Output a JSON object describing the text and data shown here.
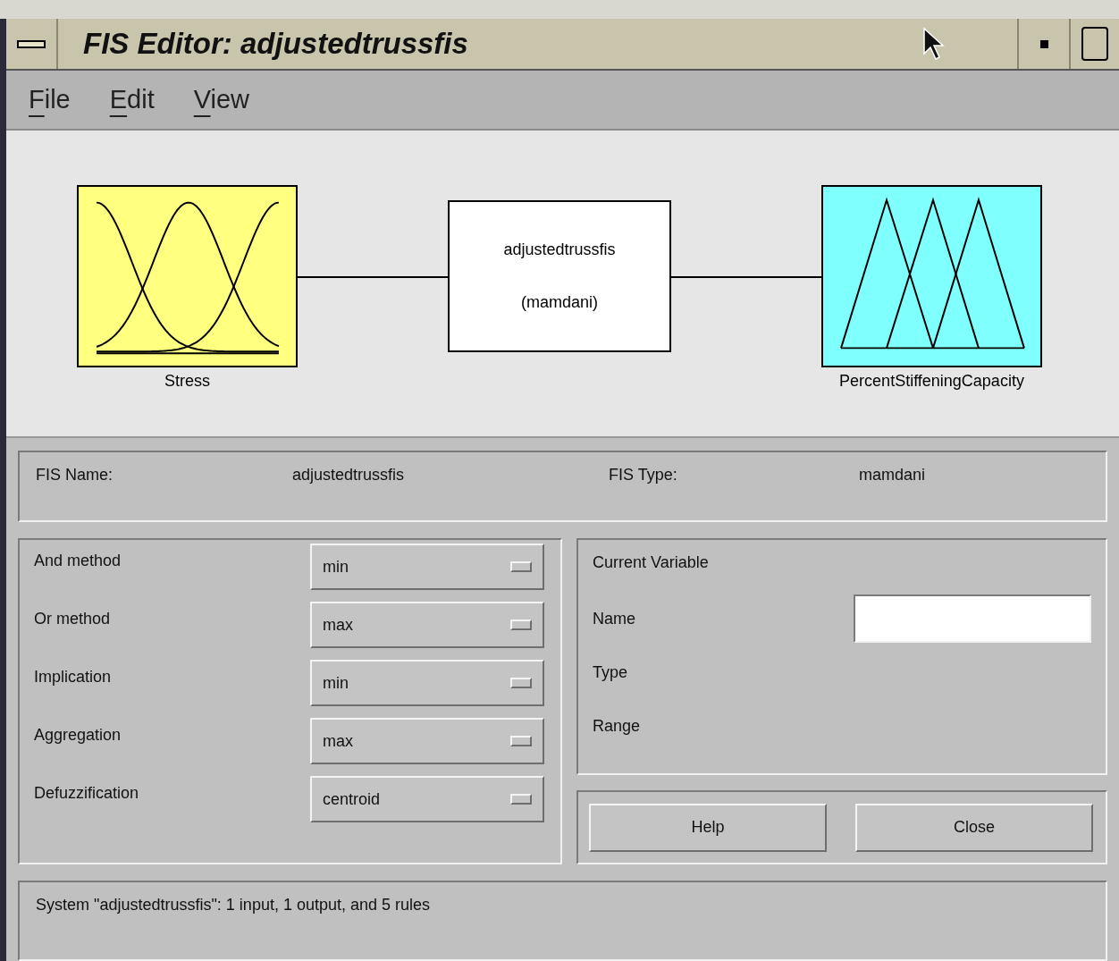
{
  "window": {
    "title": "FIS Editor: adjustedtrussfis"
  },
  "menu": [
    {
      "label": "File"
    },
    {
      "label": "Edit"
    },
    {
      "label": "View"
    }
  ],
  "diagram": {
    "input": {
      "name": "Stress",
      "kind": "gaussian"
    },
    "system": {
      "name": "adjustedtrussfis",
      "type": "(mamdani)"
    },
    "output": {
      "name": "PercentStiffeningCapacity",
      "kind": "triangular"
    }
  },
  "fis_info": {
    "name_label": "FIS Name:",
    "name_value": "adjustedtrussfis",
    "type_label": "FIS Type:",
    "type_value": "mamdani"
  },
  "methods": [
    {
      "label": "And method",
      "value": "min"
    },
    {
      "label": "Or method",
      "value": "max"
    },
    {
      "label": "Implication",
      "value": "min"
    },
    {
      "label": "Aggregation",
      "value": "max"
    },
    {
      "label": "Defuzzification",
      "value": "centroid"
    }
  ],
  "current_variable": {
    "title": "Current Variable",
    "fields": [
      {
        "label": "Name",
        "kind": "input"
      },
      {
        "label": "Type",
        "kind": "text"
      },
      {
        "label": "Range",
        "kind": "text"
      }
    ]
  },
  "buttons": [
    "Help",
    "Close"
  ],
  "status": "System \"adjustedtrussfis\": 1 input, 1 output, and 5 rules"
}
